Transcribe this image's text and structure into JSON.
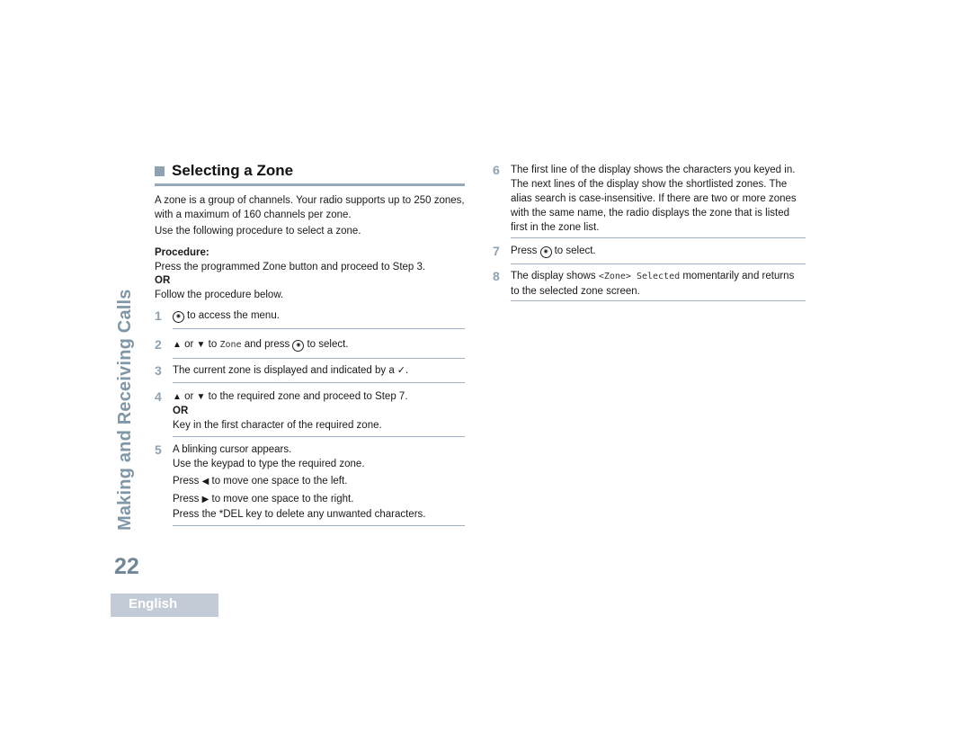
{
  "side_title": "Making and Receiving Calls",
  "page_number": "22",
  "language_tab": "English",
  "section": {
    "title": "Selecting a Zone",
    "intro": [
      "A zone is a group of channels. Your radio supports up to 250 zones, with a maximum of 160 channels per zone.",
      "Use the following procedure to select a zone."
    ],
    "procedure_label": "Procedure:",
    "procedure_line1": "Press the programmed Zone button and proceed to Step 3.",
    "or_label": "OR",
    "procedure_line2": "Follow the procedure below."
  },
  "steps": {
    "s1": {
      "num": "1",
      "text": "to access the menu."
    },
    "s2": {
      "num": "2",
      "or": "or",
      "to": "to",
      "mono": "Zone",
      "and_press": "and press",
      "tail": "to select."
    },
    "s3": {
      "num": "3",
      "text": "The current zone is displayed and indicated by a",
      "check": "✓",
      "period": "."
    },
    "s4": {
      "num": "4",
      "or": "or",
      "text": "to the required zone and proceed to Step 7.",
      "or_label": "OR",
      "line2": "Key in the first character of the required zone."
    },
    "s5": {
      "num": "5",
      "line1": "A blinking cursor appears.",
      "line2": "Use the keypad to type the required zone.",
      "press": "Press",
      "line3_tail": "to move one space to the left.",
      "line4_tail": "to move one space to the right.",
      "line5": "Press the *DEL key to delete any unwanted characters."
    },
    "s6": {
      "num": "6",
      "text": "The first line of the display shows the characters you keyed in. The next lines of the display show the shortlisted zones. The alias search is case-insensitive. If there are two or more zones with the same name, the radio displays the zone that is listed first in the zone list."
    },
    "s7": {
      "num": "7",
      "press": "Press",
      "tail": "to select."
    },
    "s8": {
      "num": "8",
      "pre": "The display shows",
      "mono": "<Zone> Selected",
      "post": "momentarily and returns to the selected zone screen."
    }
  },
  "icons": {
    "menu_ok_button": "Ⓢ",
    "up_arrow": "▲",
    "down_arrow": "▼",
    "left_arrow": "◀",
    "right_arrow": "▶"
  }
}
